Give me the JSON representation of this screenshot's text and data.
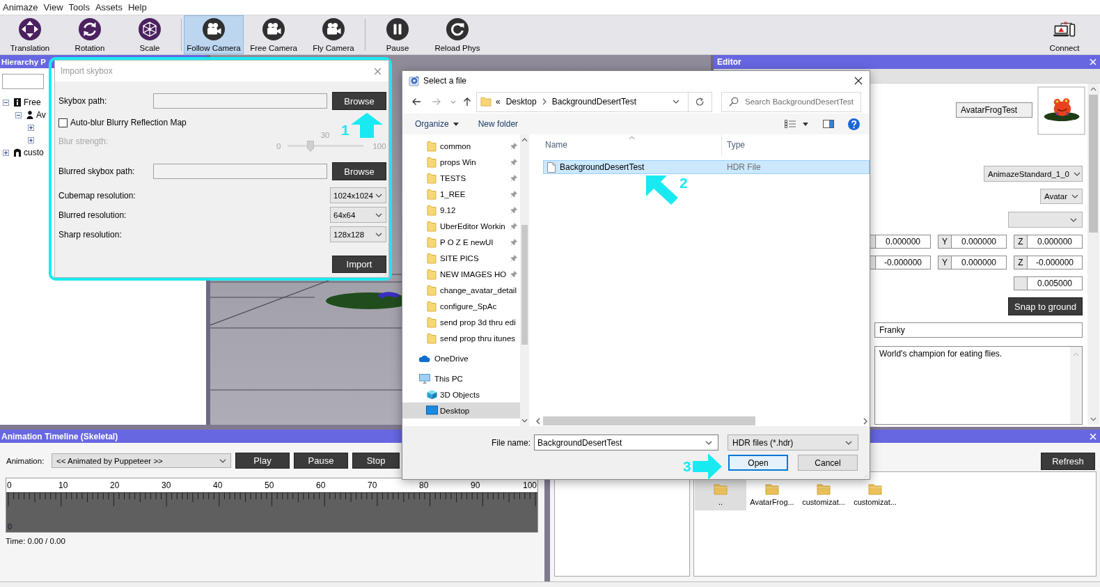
{
  "menu": [
    "Animaze",
    "View",
    "Tools",
    "Assets",
    "Help"
  ],
  "toolbar": {
    "groups": [
      {
        "items": [
          {
            "label": "Translation",
            "kind": "translate",
            "selected": false
          },
          {
            "label": "Rotation",
            "kind": "rotate",
            "selected": false
          },
          {
            "label": "Scale",
            "kind": "scale",
            "selected": false
          }
        ]
      },
      {
        "items": [
          {
            "label": "Follow Camera",
            "kind": "camera",
            "selected": true
          },
          {
            "label": "Free Camera",
            "kind": "camera",
            "selected": false
          },
          {
            "label": "Fly Camera",
            "kind": "camera",
            "selected": false
          }
        ]
      },
      {
        "items": [
          {
            "label": "Pause",
            "kind": "pause",
            "selected": false
          },
          {
            "label": "Reload Phys",
            "kind": "reload",
            "selected": false
          }
        ]
      }
    ],
    "right": [
      {
        "label": "Connect",
        "kind": "connect",
        "selected": false
      }
    ]
  },
  "hierarchy_panel": {
    "title": "Hierarchy P",
    "tree": [
      {
        "label": "Free",
        "kind": "scene",
        "expanded": true,
        "children": [
          {
            "label": "Av",
            "kind": "avatar",
            "expanded": true,
            "children": [
              {
                "expanded": false
              },
              {
                "expanded": false
              }
            ]
          }
        ]
      },
      {
        "label": "custo",
        "kind": "prop",
        "expanded": false
      }
    ]
  },
  "editor_panel": {
    "title": "Editor",
    "avatar_name": "AvatarFrogTest",
    "dropdowns": [
      "AnimazeStandard_1_0",
      "Avatar"
    ],
    "vector_rows": [
      {
        "cells": [
          {
            "value": "0.000000"
          },
          {
            "axis": "Y",
            "value": "0.000000"
          },
          {
            "axis": "Z",
            "value": "0.000000"
          }
        ]
      },
      {
        "cells": [
          {
            "value": "-0.000000"
          },
          {
            "axis": "Y",
            "value": "0.000000"
          },
          {
            "axis": "Z",
            "value": "-0.000000"
          }
        ]
      },
      {
        "cells": [
          {
            "value": "0.005000"
          }
        ]
      }
    ],
    "snap_button": "Snap to ground",
    "name_value": "Franky",
    "description": "World's champion for eating flies."
  },
  "timeline_panel": {
    "title": "Animation Timeline (Skeletal)",
    "animation_label": "Animation:",
    "animation_value": "<< Animated by Puppeteer >>",
    "buttons": [
      "Play",
      "Pause",
      "Stop"
    ],
    "ruler_labels": [
      "0",
      "10",
      "20",
      "30",
      "40",
      "50",
      "60",
      "70",
      "80",
      "90",
      "100"
    ],
    "track_label": "0",
    "time": "Time: 0.00 / 0.00"
  },
  "asset_panel": {
    "refresh_button": "Refresh",
    "items": [
      {
        "label": "..",
        "selected": true
      },
      {
        "label": "AvatarFrog...",
        "selected": false
      },
      {
        "label": "customizat...",
        "selected": false
      },
      {
        "label": "customizat...",
        "selected": false
      }
    ]
  },
  "import_skybox_dialog": {
    "title": "Import skybox",
    "rows": [
      {
        "kind": "path",
        "label": "Skybox path:",
        "button": "Browse"
      },
      {
        "kind": "checkbox",
        "label": "Auto-blur Blurry Reflection Map",
        "checked": false
      },
      {
        "kind": "slider",
        "label": "Blur strength:",
        "disabled": true,
        "min_label": "0",
        "max_label": "100",
        "reading": "30",
        "level": 0.3
      },
      {
        "kind": "path",
        "label": "Blurred skybox path:",
        "button": "Browse"
      },
      {
        "kind": "select",
        "label": "Cubemap resolution:",
        "value": "1024x1024"
      },
      {
        "kind": "select",
        "label": "Blurred resolution:",
        "value": "64x64"
      },
      {
        "kind": "select",
        "label": "Sharp resolution:",
        "value": "128x128"
      }
    ],
    "import_button": "Import",
    "callout": {
      "number": "1",
      "kind": "up"
    }
  },
  "file_dialog": {
    "title": "Select a file",
    "address": {
      "overflow": "«",
      "crumbs": [
        "Desktop",
        "BackgroundDesertTest"
      ]
    },
    "search": {
      "placeholder": "Search BackgroundDesertTest"
    },
    "commands": [
      {
        "label": "Organize",
        "menu": true
      },
      {
        "label": "New folder",
        "menu": false
      }
    ],
    "nav": [
      {
        "label": "common",
        "kind": "folder",
        "pinned": true,
        "selected": false
      },
      {
        "label": "props Win",
        "kind": "folder",
        "pinned": true,
        "selected": false
      },
      {
        "label": "TESTS",
        "kind": "folder",
        "pinned": true,
        "selected": false
      },
      {
        "label": "1_REE",
        "kind": "folder",
        "pinned": true,
        "selected": false
      },
      {
        "label": "9.12",
        "kind": "folder",
        "pinned": true,
        "selected": false
      },
      {
        "label": "UberEditor Workin",
        "kind": "folder",
        "pinned": true,
        "selected": false
      },
      {
        "label": "P O Z E newUI",
        "kind": "folder",
        "pinned": true,
        "selected": false
      },
      {
        "label": "SITE PICS",
        "kind": "folder",
        "pinned": true,
        "selected": false
      },
      {
        "label": "NEW IMAGES HO",
        "kind": "folder",
        "pinned": true,
        "selected": false
      },
      {
        "label": "change_avatar_detail",
        "kind": "folder",
        "pinned": false,
        "selected": false
      },
      {
        "label": "configure_SpAc",
        "kind": "folder",
        "pinned": false,
        "selected": false
      },
      {
        "label": "send prop 3d thru edi",
        "kind": "folder",
        "pinned": false,
        "selected": false
      },
      {
        "label": "send prop thru itunes",
        "kind": "folder",
        "pinned": false,
        "selected": false
      },
      {
        "label": "OneDrive",
        "kind": "cloud",
        "pinned": false,
        "selected": false
      },
      {
        "label": "This PC",
        "kind": "pc",
        "pinned": false,
        "selected": false,
        "children": [
          {
            "label": "3D Objects",
            "kind": "objects",
            "pinned": false,
            "selected": false
          },
          {
            "label": "Desktop",
            "kind": "desktop",
            "pinned": false,
            "selected": true
          }
        ]
      }
    ],
    "columns": [
      {
        "label": "Name",
        "sorted": true
      },
      {
        "label": "Type",
        "sorted": false
      }
    ],
    "files": [
      {
        "name": "BackgroundDesertTest",
        "type": "HDR File",
        "selected": true
      }
    ],
    "file_name_label": "File name:",
    "file_name": "BackgroundDesertTest",
    "filter": "HDR files (*.hdr)",
    "buttons": [
      {
        "label": "Open",
        "focused": true
      },
      {
        "label": "Cancel",
        "focused": false
      }
    ],
    "file_callout": {
      "number": "2",
      "kind": "up-left"
    },
    "open_callout": {
      "number": "3",
      "kind": "right"
    }
  }
}
